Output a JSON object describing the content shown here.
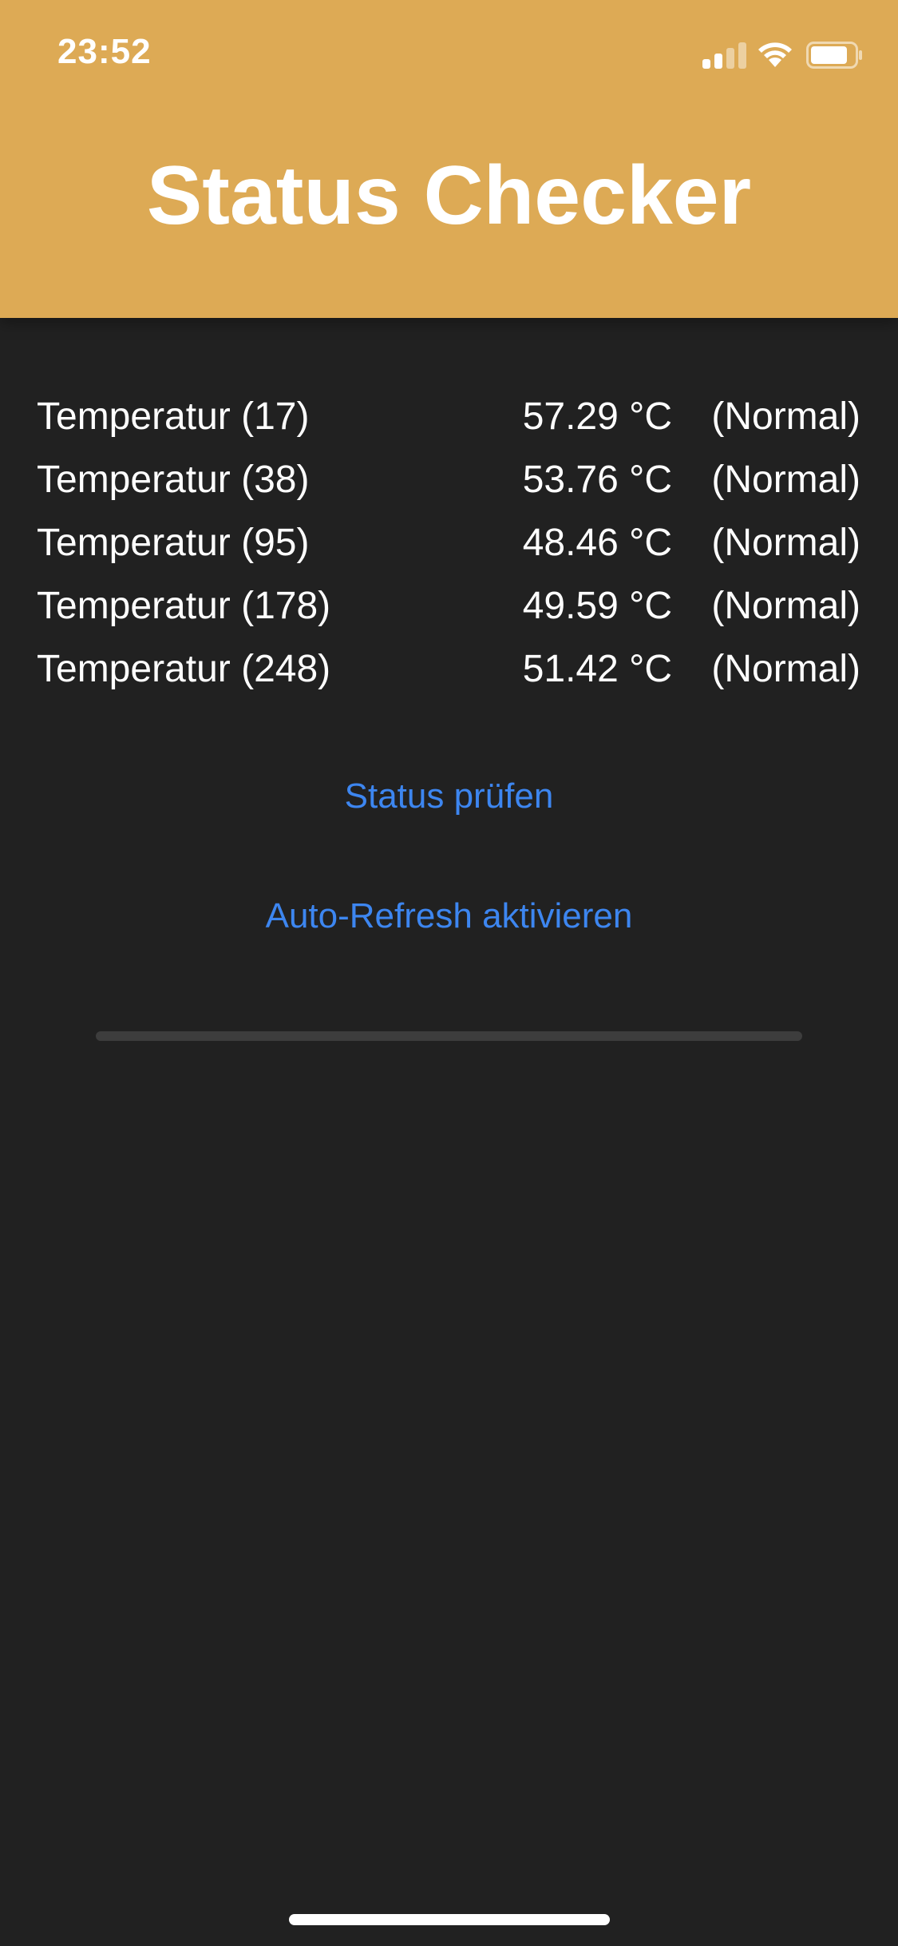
{
  "status_bar": {
    "time": "23:52",
    "signal_icon": "cellular-signal-icon",
    "wifi_icon": "wifi-icon",
    "battery_icon": "battery-icon"
  },
  "header": {
    "title": "Status Checker",
    "background_color": "#DDAA55"
  },
  "readings": [
    {
      "label": "Temperatur (17)",
      "value": "57.29 °C",
      "status": "(Normal)"
    },
    {
      "label": "Temperatur (38)",
      "value": "53.76 °C",
      "status": "(Normal)"
    },
    {
      "label": "Temperatur (95)",
      "value": "48.46 °C",
      "status": "(Normal)"
    },
    {
      "label": "Temperatur (178)",
      "value": "49.59 °C",
      "status": "(Normal)"
    },
    {
      "label": "Temperatur (248)",
      "value": "51.42 °C",
      "status": "(Normal)"
    }
  ],
  "actions": {
    "check_status_label": "Status prüfen",
    "auto_refresh_label": "Auto-Refresh aktivieren",
    "link_color": "#3D86F0"
  },
  "progress": {
    "fraction": 0
  },
  "colors": {
    "background": "#212121",
    "text": "#FFFFFF"
  }
}
